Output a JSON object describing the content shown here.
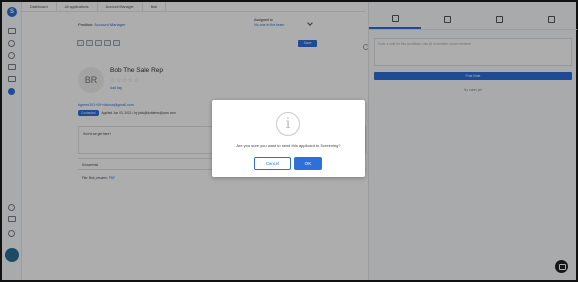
{
  "breadcrumbs": [
    "Dashboard",
    "All applications",
    "Account Manager",
    "Bob"
  ],
  "position": {
    "label": "Position:",
    "value": "Account Manager"
  },
  "assigned": {
    "label": "Assigned to",
    "value": "No one in the team"
  },
  "toolbar": {
    "save_label": "Save"
  },
  "candidate": {
    "initials": "BR",
    "name": "Bob The Sale Rep",
    "rating": "☆☆☆☆☆",
    "add_tag": "Add tag",
    "email": "bgreen201+09+dsfcsa@gmail.com",
    "status_badge": "Contacted",
    "applied_info": "Applied Jun 03, 2021 / by jack@dotdemo@com.com"
  },
  "application_card": {
    "label": "How'd we get here?"
  },
  "documents": {
    "header": "Documents",
    "file_label": "File: Bob_resume.",
    "file_ext": "PDF"
  },
  "notes": {
    "placeholder": "Enter a note for this candidate. Use @ to mention a team member",
    "post_label": "Post Note",
    "empty_text": "No notes yet"
  },
  "modal": {
    "message": "Are you sure you want to send this applicant to Screening?",
    "cancel_label": "Cancel",
    "ok_label": "OK"
  },
  "colors": {
    "accent": "#2f6fdc",
    "overlay": "rgba(0,0,0,0.32)"
  }
}
